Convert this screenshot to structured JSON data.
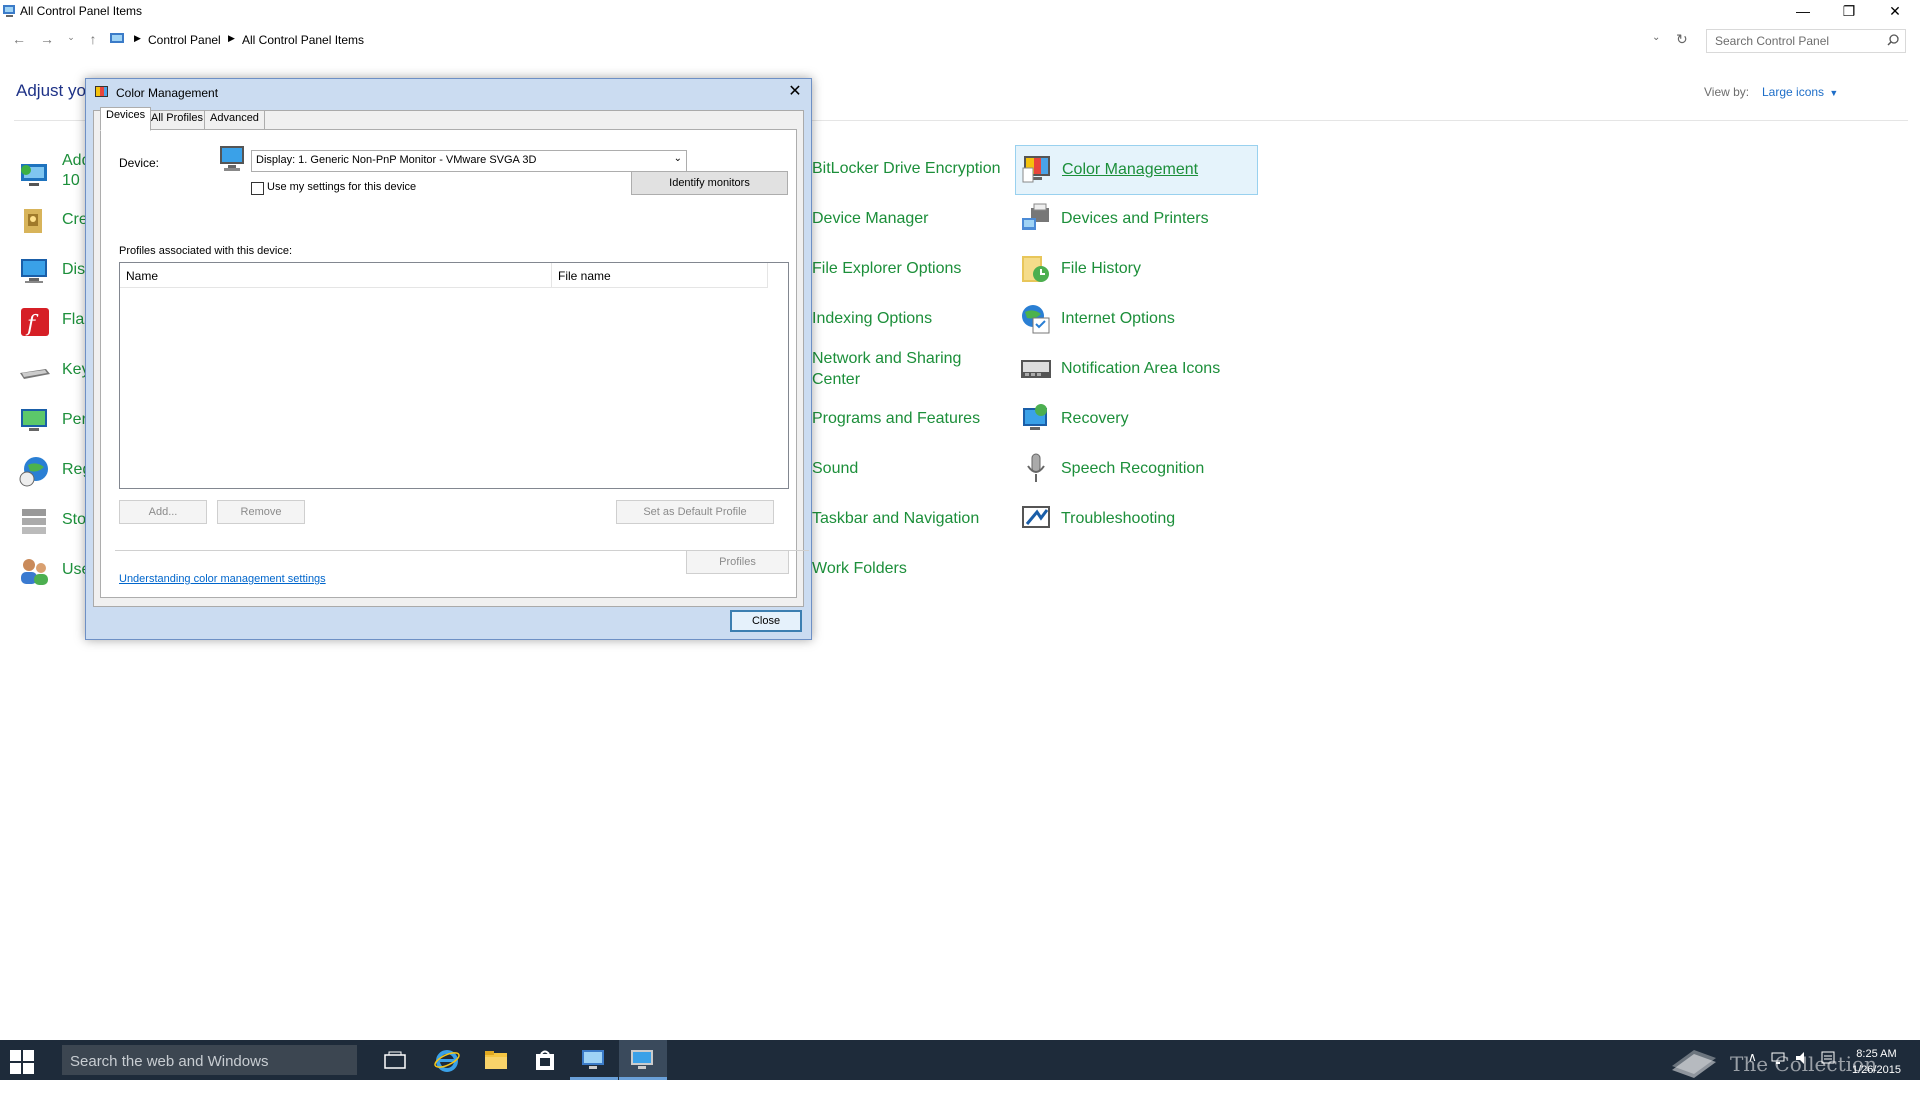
{
  "window": {
    "title": "All Control Panel Items"
  },
  "address": {
    "crumbs": [
      "Control Panel",
      "All Control Panel Items"
    ]
  },
  "search": {
    "placeholder": "Search Control Panel"
  },
  "main": {
    "heading": "Adjust yo",
    "view_by_label": "View by:",
    "view_by_value": "Large icons",
    "left_items": [
      {
        "label": "Add",
        "label2": "10"
      },
      {
        "label": "Cre"
      },
      {
        "label": "Dis"
      },
      {
        "label": "Flas"
      },
      {
        "label": "Key"
      },
      {
        "label": "Per"
      },
      {
        "label": "Reg"
      },
      {
        "label": "Sto"
      },
      {
        "label": "Use"
      }
    ],
    "middle_items": [
      {
        "label": "BitLocker Drive Encryption"
      },
      {
        "label": "Device Manager"
      },
      {
        "label": "File Explorer Options"
      },
      {
        "label": "Indexing Options"
      },
      {
        "label": "Network and Sharing",
        "label2": "Center"
      },
      {
        "label": "Programs and Features"
      },
      {
        "label": "Sound"
      },
      {
        "label": "Taskbar and Navigation"
      },
      {
        "label": "Work Folders"
      }
    ],
    "right_items": [
      {
        "label": "Color Management"
      },
      {
        "label": "Devices and Printers"
      },
      {
        "label": "File History"
      },
      {
        "label": "Internet Options"
      },
      {
        "label": "Notification Area Icons"
      },
      {
        "label": "Recovery"
      },
      {
        "label": "Speech Recognition"
      },
      {
        "label": "Troubleshooting"
      }
    ]
  },
  "dialog": {
    "title": "Color Management",
    "tabs": [
      "Devices",
      "All Profiles",
      "Advanced"
    ],
    "device_label": "Device:",
    "device_value": "Display: 1. Generic Non-PnP Monitor - VMware SVGA 3D",
    "use_settings_label": "Use my settings for this device",
    "identify_button": "Identify monitors",
    "profiles_label": "Profiles associated with this device:",
    "columns": [
      "Name",
      "File name"
    ],
    "add_button": "Add...",
    "remove_button": "Remove",
    "set_default_button": "Set as Default Profile",
    "profiles_button": "Profiles",
    "help_link": "Understanding color management settings",
    "close_button": "Close"
  },
  "taskbar": {
    "search_placeholder": "Search the web and Windows",
    "time": "8:25 AM",
    "date": "1/26/2015",
    "watermark": "The Collection Book"
  }
}
